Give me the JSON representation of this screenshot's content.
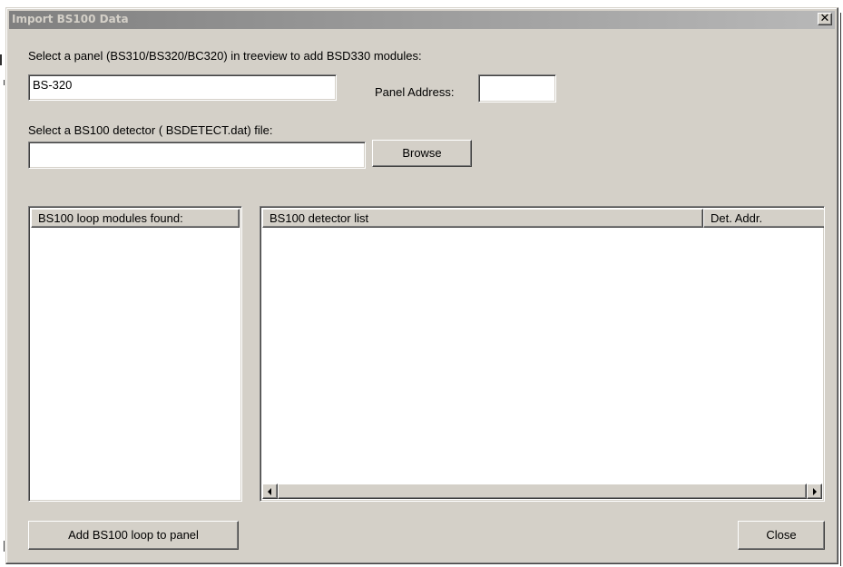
{
  "dialog": {
    "title": "Import BS100 Data",
    "close_glyph": "✕"
  },
  "panel_select": {
    "label": "Select a panel (BS310/BS320/BC320) in treeview to add BSD330 modules:",
    "value": "BS-320",
    "address_label": "Panel Address:",
    "address_value": ""
  },
  "file_select": {
    "label": "Select a BS100 detector ( BSDETECT.dat) file:",
    "path_value": "",
    "browse_label": "Browse"
  },
  "modules_list": {
    "header": "BS100 loop modules found:",
    "items": []
  },
  "detector_list": {
    "columns": [
      "BS100 detector list",
      "Det. Addr."
    ],
    "rows": []
  },
  "footer": {
    "add_label": "Add BS100 loop to panel",
    "close_label": "Close"
  },
  "colors": {
    "face": "#d4d0c8",
    "title_gradient_start": "#808080",
    "title_gradient_end": "#b8b8b8",
    "title_text": "#d4d0c8"
  },
  "icons": {
    "close": "close-icon",
    "scroll_left": "scroll-left-arrow-icon",
    "scroll_right": "scroll-right-arrow-icon"
  }
}
